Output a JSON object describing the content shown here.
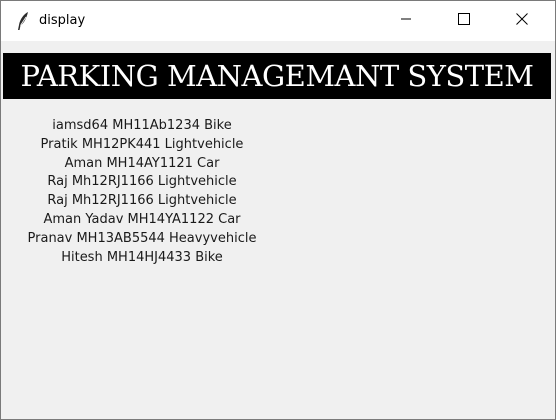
{
  "window": {
    "title": "display",
    "controls": {
      "minimize_icon": "minimize-icon",
      "maximize_icon": "maximize-icon",
      "close_icon": "close-icon"
    }
  },
  "banner": {
    "title": "PARKING MANAGEMANT SYSTEM",
    "background": "#000000",
    "color": "#ffffff"
  },
  "records": [
    "iamsd64 MH11Ab1234 Bike",
    "Pratik MH12PK441 Lightvehicle",
    "Aman MH14AY1121 Car",
    "Raj Mh12RJ1166 Lightvehicle",
    "Raj Mh12RJ1166 Lightvehicle",
    "Aman Yadav MH14YA1122 Car",
    "Pranav MH13AB5544 Heavyvehicle",
    "Hitesh MH14HJ4433 Bike"
  ]
}
